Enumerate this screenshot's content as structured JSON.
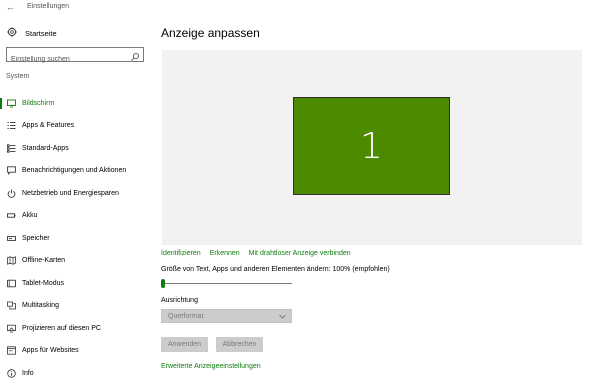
{
  "window": {
    "back_glyph": "←",
    "title": "Einstellungen"
  },
  "sidebar": {
    "home_label": "Startseite",
    "home_icon": "gear-icon",
    "search_placeholder": "Einstellung suchen",
    "section_label": "System",
    "items": [
      {
        "label": "Bildschirm",
        "icon": "display-icon",
        "active": true
      },
      {
        "label": "Apps & Features",
        "icon": "apps-list-icon",
        "active": false
      },
      {
        "label": "Standard-Apps",
        "icon": "default-apps-icon",
        "active": false
      },
      {
        "label": "Benachrichtigungen und Aktionen",
        "icon": "notification-icon",
        "active": false
      },
      {
        "label": "Netzbetrieb und Energiesparen",
        "icon": "power-icon",
        "active": false
      },
      {
        "label": "Akku",
        "icon": "battery-icon",
        "active": false
      },
      {
        "label": "Speicher",
        "icon": "storage-icon",
        "active": false
      },
      {
        "label": "Offline-Karten",
        "icon": "map-icon",
        "active": false
      },
      {
        "label": "Tablet-Modus",
        "icon": "tablet-icon",
        "active": false
      },
      {
        "label": "Multitasking",
        "icon": "multitasking-icon",
        "active": false
      },
      {
        "label": "Projizieren auf diesen PC",
        "icon": "project-icon",
        "active": false
      },
      {
        "label": "Apps für Websites",
        "icon": "web-apps-icon",
        "active": false
      },
      {
        "label": "Info",
        "icon": "info-icon",
        "active": false
      }
    ]
  },
  "main": {
    "title": "Anzeige anpassen",
    "monitor_number": "1",
    "links": [
      "Identifizieren",
      "Erkennen",
      "Mit drahtloser Anzeige verbinden"
    ],
    "scale_label": "Größe von Text, Apps und anderen Elementen ändern: 100% (empfohlen)",
    "scale_slider_value": 0,
    "orientation_label": "Ausrichtung",
    "orientation_value": "Querformat",
    "apply_label": "Anwenden",
    "cancel_label": "Abbrechen",
    "advanced_link": "Erweiterte Anzeigeeinstellungen"
  },
  "colors": {
    "accent": "#107c10",
    "monitor_fill": "#4c8a00",
    "preview_bg": "#f2f2f2",
    "disabled_bg": "#cccccc",
    "disabled_text": "#7a7a7a"
  }
}
